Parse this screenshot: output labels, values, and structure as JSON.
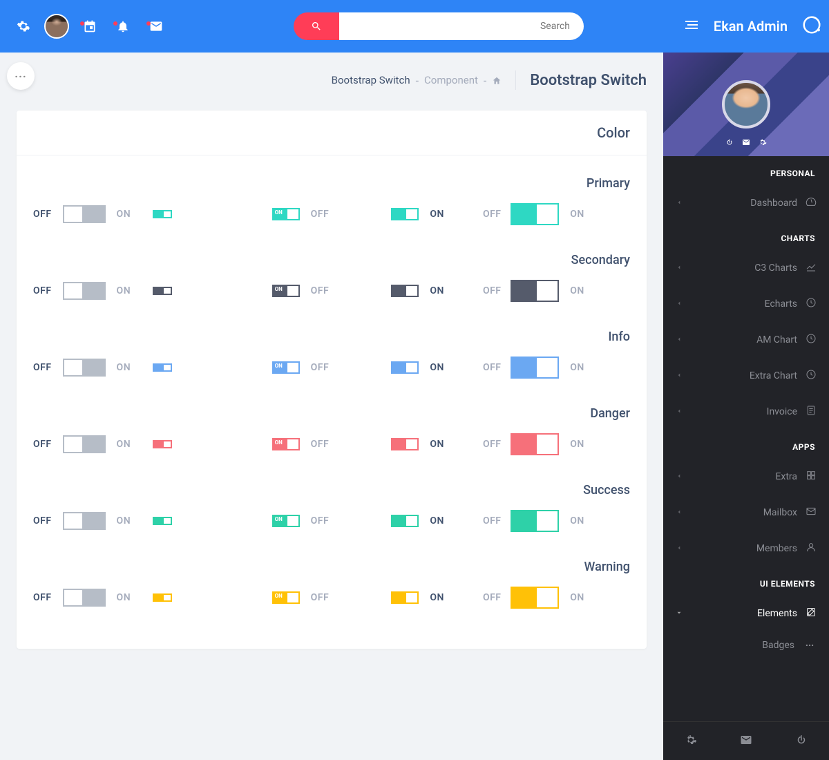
{
  "header": {
    "search_placeholder": "Search",
    "brand": "Ekan Admin"
  },
  "breadcrumb": {
    "item1": "Bootstrap Switch",
    "item2": "Component",
    "title": "Bootstrap Switch"
  },
  "card": {
    "title": "Color"
  },
  "labels": {
    "on": "ON",
    "off": "OFF"
  },
  "sections": [
    {
      "title": "Primary",
      "color_class": "c-primary"
    },
    {
      "title": "Secondary",
      "color_class": "c-secondary"
    },
    {
      "title": "Info",
      "color_class": "c-info"
    },
    {
      "title": "Danger",
      "color_class": "c-danger"
    },
    {
      "title": "Success",
      "color_class": "c-success"
    },
    {
      "title": "Warning",
      "color_class": "c-warning"
    }
  ],
  "sidebar": {
    "groups": {
      "personal": "PERSONAL",
      "charts": "CHARTS",
      "apps": "APPS",
      "ui": "UI ELEMENTS"
    },
    "items": {
      "dashboard": "Dashboard",
      "c3": "C3 Charts",
      "echarts": "Echarts",
      "am": "AM Chart",
      "extrac": "Extra Chart",
      "invoice": "Invoice",
      "extra": "Extra",
      "mailbox": "Mailbox",
      "members": "Members",
      "elements": "Elements",
      "badges": "Badges"
    }
  }
}
